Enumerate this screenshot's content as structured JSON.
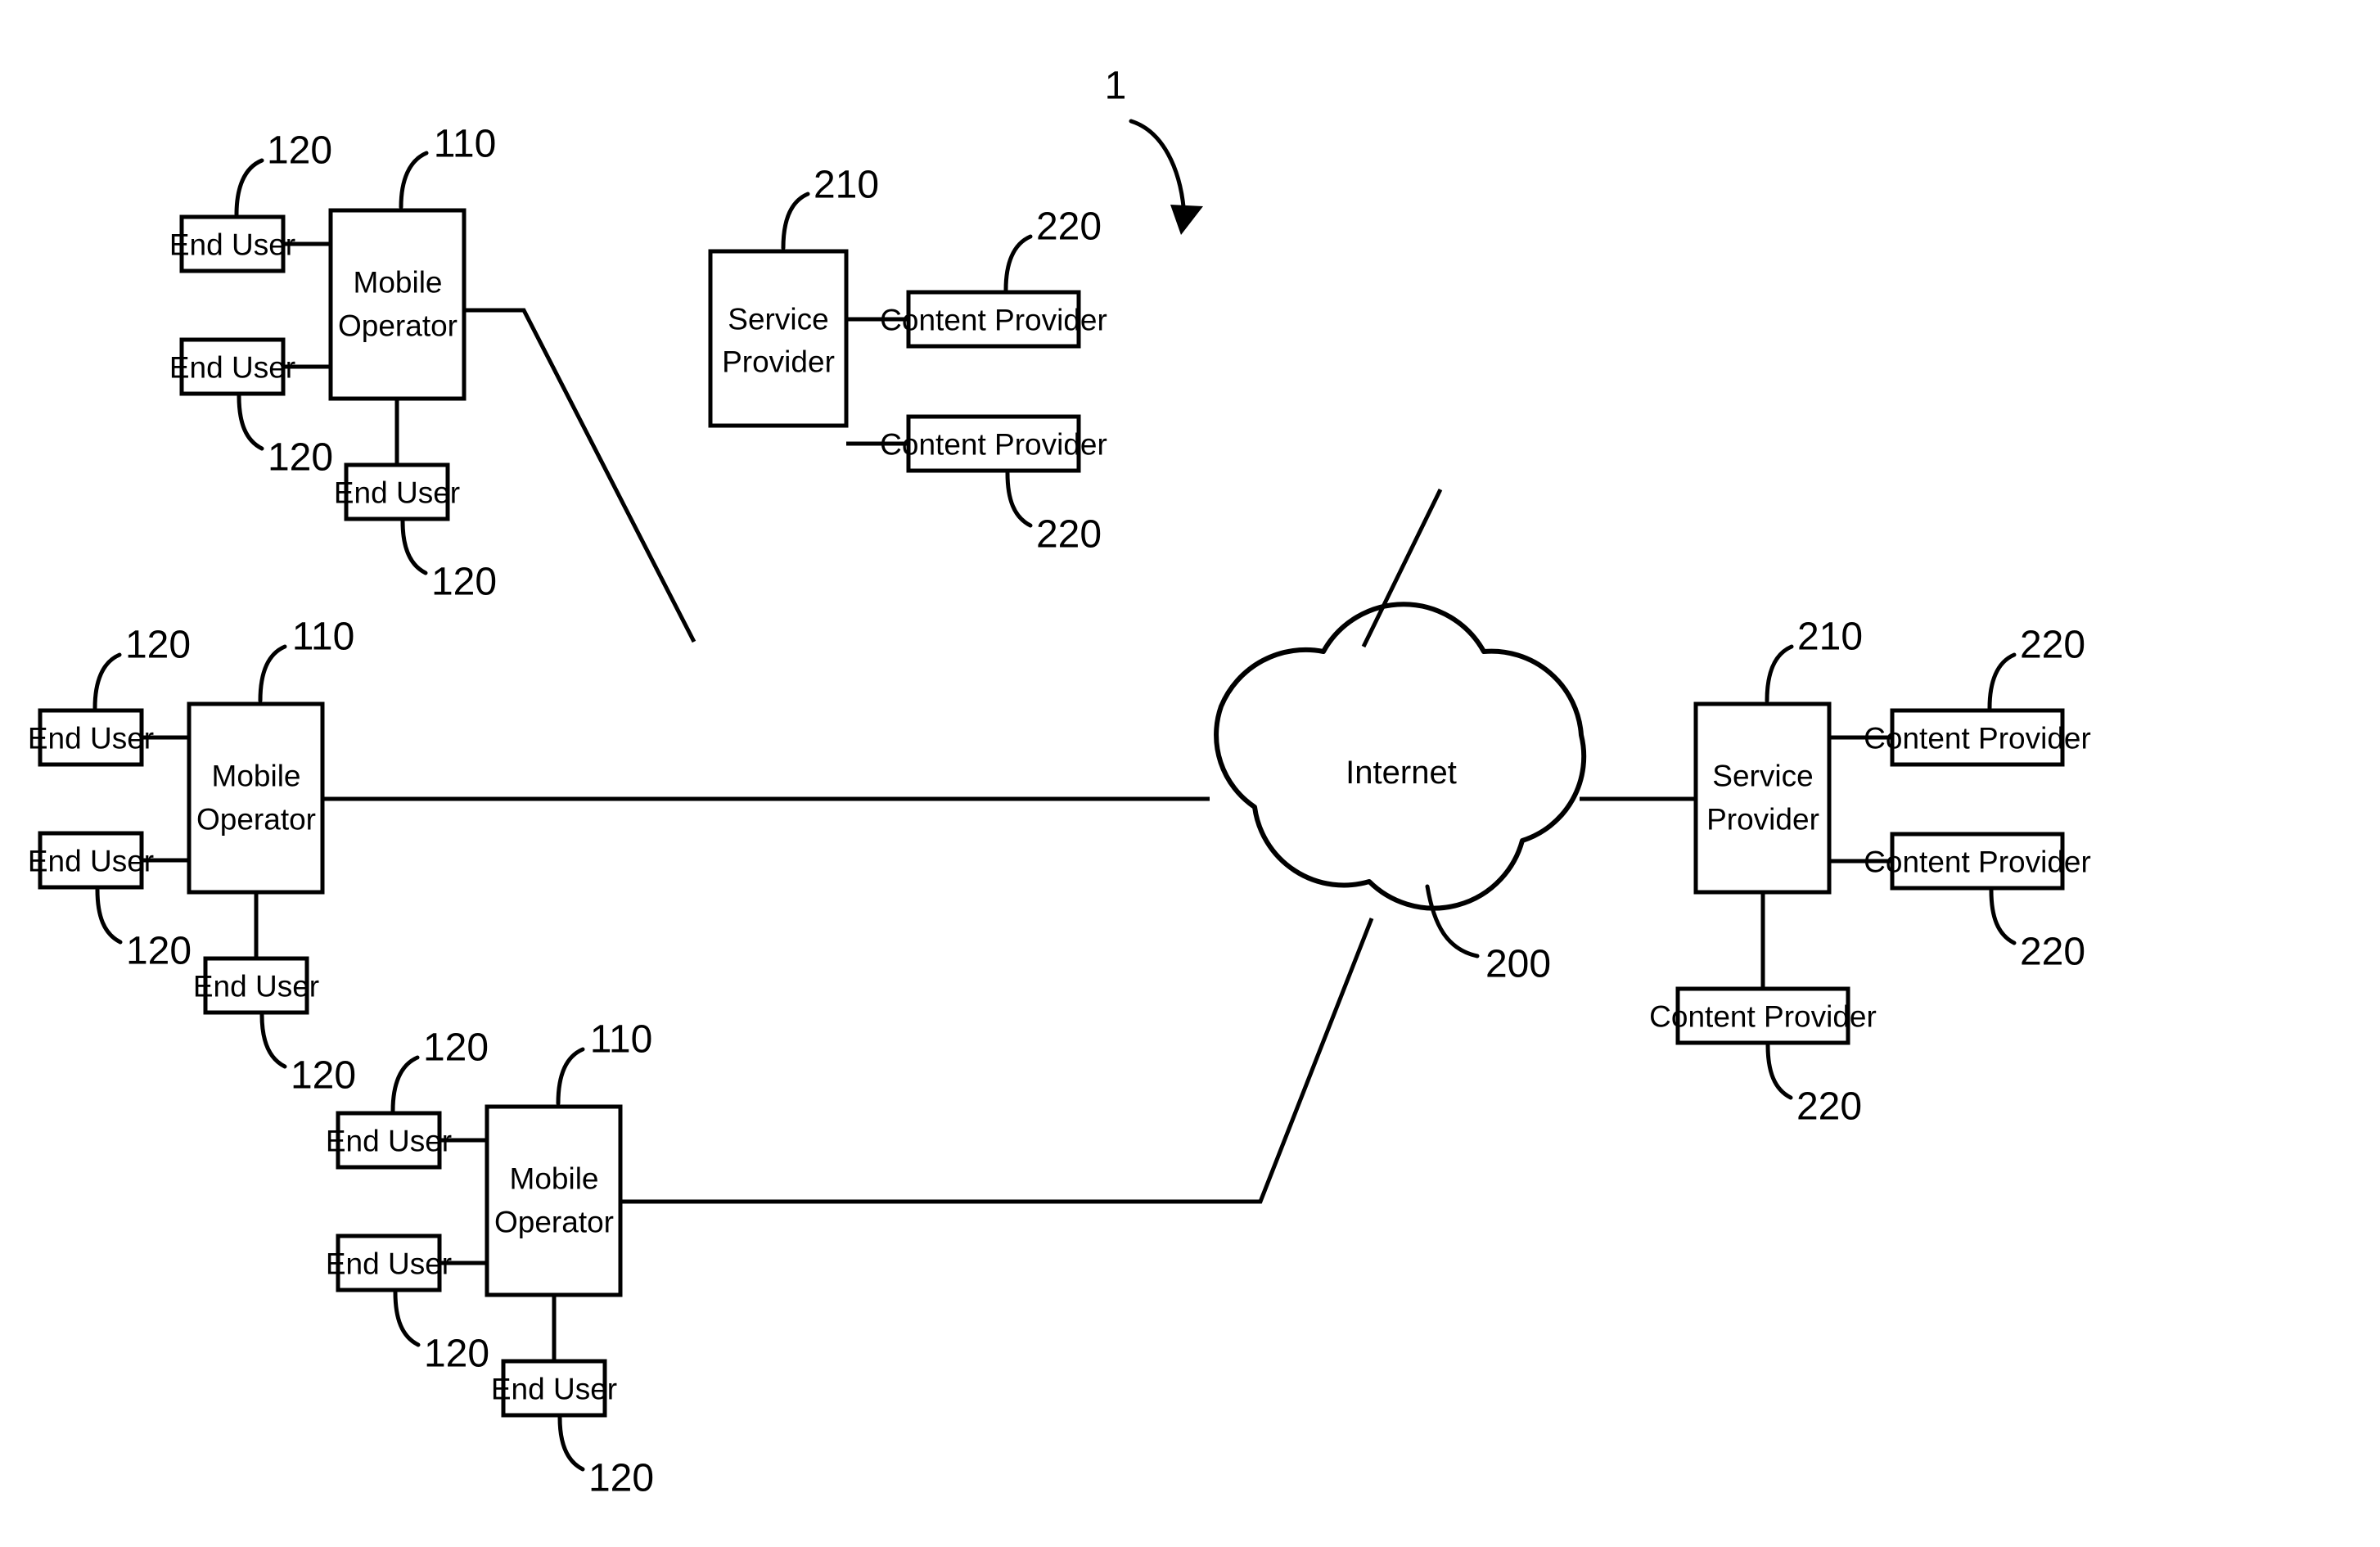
{
  "figure": {
    "figure_number": "1",
    "cloud": {
      "label": "Internet",
      "ref": "200"
    },
    "refs": {
      "mobile_operator": "110",
      "end_user": "120",
      "service_provider": "210",
      "content_provider": "220"
    },
    "node_labels": {
      "end_user": "End User",
      "mobile_operator_line1": "Mobile",
      "mobile_operator_line2": "Operator",
      "service_provider_line1": "Service",
      "service_provider_line2": "Provider",
      "content_provider": "Content Provider"
    },
    "clusters": [
      {
        "id": "mobile-operator-top",
        "hub": "Mobile Operator",
        "hub_ref": "110",
        "leaves": [
          {
            "label": "End User",
            "ref": "120",
            "position": "left-upper"
          },
          {
            "label": "End User",
            "ref": "120",
            "position": "left-lower"
          },
          {
            "label": "End User",
            "ref": "120",
            "position": "bottom"
          }
        ]
      },
      {
        "id": "mobile-operator-middle",
        "hub": "Mobile Operator",
        "hub_ref": "110",
        "leaves": [
          {
            "label": "End User",
            "ref": "120",
            "position": "left-upper"
          },
          {
            "label": "End User",
            "ref": "120",
            "position": "left-lower"
          },
          {
            "label": "End User",
            "ref": "120",
            "position": "bottom"
          }
        ]
      },
      {
        "id": "mobile-operator-bottom",
        "hub": "Mobile Operator",
        "hub_ref": "110",
        "leaves": [
          {
            "label": "End User",
            "ref": "120",
            "position": "left-upper"
          },
          {
            "label": "End User",
            "ref": "120",
            "position": "left-lower"
          },
          {
            "label": "End User",
            "ref": "120",
            "position": "bottom"
          }
        ]
      },
      {
        "id": "service-provider-top",
        "hub": "Service Provider",
        "hub_ref": "210",
        "leaves": [
          {
            "label": "Content Provider",
            "ref": "220",
            "position": "right-upper"
          },
          {
            "label": "Content Provider",
            "ref": "220",
            "position": "right-lower"
          }
        ]
      },
      {
        "id": "service-provider-middle",
        "hub": "Service Provider",
        "hub_ref": "210",
        "leaves": [
          {
            "label": "Content Provider",
            "ref": "220",
            "position": "right-upper"
          },
          {
            "label": "Content Provider",
            "ref": "220",
            "position": "right-lower"
          },
          {
            "label": "Content Provider",
            "ref": "220",
            "position": "bottom"
          }
        ]
      }
    ]
  }
}
